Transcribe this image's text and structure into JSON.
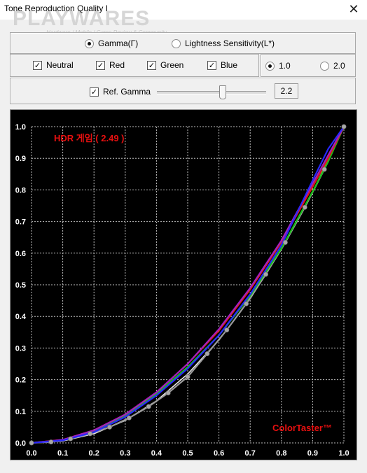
{
  "window": {
    "title": "Tone Reproduction Quality I",
    "close_glyph": "✕",
    "watermark": "PLAYWARES",
    "watermark_sub": "Hardware / Mobile / Game Review & Community"
  },
  "mode": {
    "options": [
      {
        "label": "Gamma(Γ)",
        "selected": true
      },
      {
        "label": "Lightness Sensitivity(L*)",
        "selected": false
      }
    ]
  },
  "channels": [
    {
      "label": "Neutral",
      "checked": true
    },
    {
      "label": "Red",
      "checked": true
    },
    {
      "label": "Green",
      "checked": true
    },
    {
      "label": "Blue",
      "checked": true
    }
  ],
  "scale": {
    "options": [
      {
        "label": "1.0",
        "selected": true
      },
      {
        "label": "2.0",
        "selected": false
      }
    ]
  },
  "ref_gamma": {
    "label": "Ref. Gamma",
    "checked": true,
    "value": "2.2",
    "slider_fraction": 0.58
  },
  "chart_data": {
    "type": "line",
    "annotation": "HDR 게임 ( 2.49 )",
    "brand": "ColorTaster™",
    "xlim": [
      0,
      1
    ],
    "ylim": [
      0,
      1
    ],
    "grid": true,
    "x_ticks": [
      "0.0",
      "0.1",
      "0.2",
      "0.3",
      "0.4",
      "0.5",
      "0.6",
      "0.7",
      "0.8",
      "0.9",
      "1.0"
    ],
    "y_ticks": [
      "0.0",
      "0.1",
      "0.2",
      "0.3",
      "0.4",
      "0.5",
      "0.6",
      "0.7",
      "0.8",
      "0.9",
      "1.0"
    ],
    "colors": {
      "neutral": "#9a9a9a",
      "red": "#e01818",
      "green": "#18c018",
      "blue": "#2828ff",
      "purple": "#a020c0",
      "reference": "#e8e8e8",
      "annotation": "#e81010",
      "brand": "#e81010"
    },
    "series": [
      {
        "key": "reference",
        "x": [
          0,
          0.1,
          0.2,
          0.3,
          0.4,
          0.5,
          0.6,
          0.7,
          0.8,
          0.9,
          1.0
        ],
        "y": [
          0,
          0.006,
          0.029,
          0.071,
          0.133,
          0.218,
          0.325,
          0.456,
          0.612,
          0.793,
          1.0
        ]
      },
      {
        "key": "purple",
        "x": [
          0,
          0.1,
          0.2,
          0.3,
          0.4,
          0.5,
          0.6,
          0.7,
          0.8,
          0.9,
          0.95,
          1.0
        ],
        "y": [
          0,
          0.01,
          0.04,
          0.09,
          0.16,
          0.25,
          0.36,
          0.49,
          0.64,
          0.82,
          0.91,
          1.0
        ]
      },
      {
        "key": "red",
        "x": [
          0,
          0.1,
          0.2,
          0.3,
          0.4,
          0.5,
          0.6,
          0.7,
          0.8,
          0.9,
          0.95,
          1.0
        ],
        "y": [
          0,
          0.01,
          0.04,
          0.09,
          0.16,
          0.25,
          0.355,
          0.485,
          0.635,
          0.81,
          0.9,
          1.0
        ]
      },
      {
        "key": "green",
        "x": [
          0,
          0.1,
          0.2,
          0.3,
          0.4,
          0.5,
          0.6,
          0.7,
          0.8,
          0.9,
          0.95,
          1.0
        ],
        "y": [
          0,
          0.009,
          0.036,
          0.085,
          0.155,
          0.24,
          0.34,
          0.465,
          0.615,
          0.795,
          0.89,
          1.0
        ]
      },
      {
        "key": "blue",
        "x": [
          0,
          0.1,
          0.2,
          0.3,
          0.4,
          0.5,
          0.6,
          0.7,
          0.8,
          0.9,
          0.95,
          1.0
        ],
        "y": [
          0,
          0.008,
          0.034,
          0.082,
          0.15,
          0.235,
          0.34,
          0.47,
          0.625,
          0.83,
          0.93,
          1.0
        ]
      },
      {
        "key": "neutral",
        "x": [
          0,
          0.0625,
          0.125,
          0.1875,
          0.25,
          0.3125,
          0.375,
          0.4375,
          0.5,
          0.5625,
          0.625,
          0.6875,
          0.75,
          0.8125,
          0.875,
          0.9375,
          1.0
        ],
        "y": [
          0,
          0.003,
          0.013,
          0.029,
          0.05,
          0.079,
          0.115,
          0.158,
          0.209,
          0.282,
          0.357,
          0.44,
          0.533,
          0.634,
          0.745,
          0.865,
          1.0
        ]
      }
    ],
    "markers_on": "neutral"
  }
}
